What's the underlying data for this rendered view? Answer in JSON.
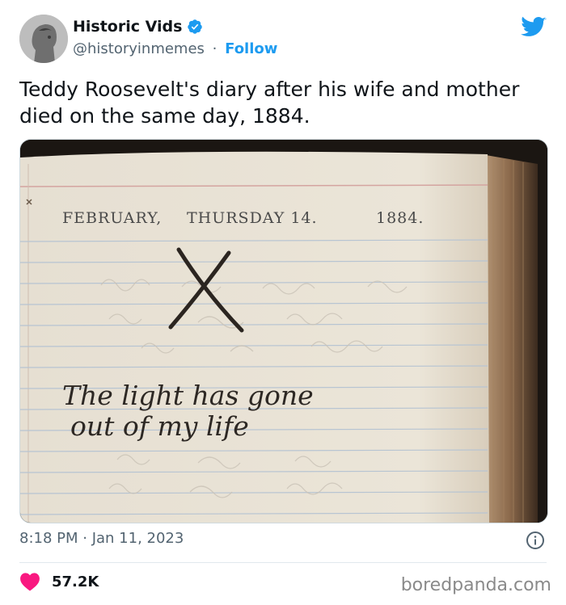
{
  "tweet": {
    "author": {
      "display_name": "Historic Vids",
      "handle": "@historyinmemes",
      "follow_label": "Follow",
      "separator": "·"
    },
    "text": "Teddy Roosevelt's diary after his wife and mother died on the same day, 1884.",
    "media": {
      "diary_header_month": "FEBRUARY,",
      "diary_header_day": "THURSDAY 14.",
      "diary_header_year": "1884.",
      "handwriting_line1": "The light has gone",
      "handwriting_line2": "out of my life"
    },
    "timestamp": "8:18 PM · Jan 11, 2023",
    "likes": "57.2K"
  },
  "watermark": "boredpanda.com",
  "colors": {
    "brand_blue": "#1d9bf0",
    "like_pink": "#f91880",
    "secondary_text": "#536471"
  },
  "icons": [
    "verified-badge-icon",
    "twitter-bird-icon",
    "info-icon",
    "heart-icon"
  ]
}
